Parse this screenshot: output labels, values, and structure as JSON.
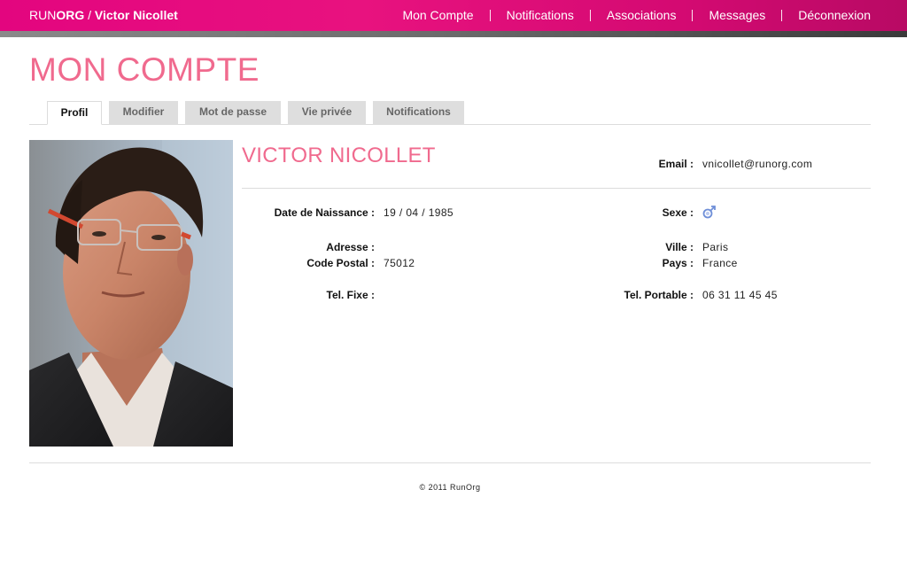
{
  "header": {
    "brand_prefix": "RUN",
    "brand_bold": "ORG",
    "brand_sep": " / ",
    "user_name": "Victor Nicollet",
    "nav": [
      "Mon Compte",
      "Notifications",
      "Associations",
      "Messages",
      "Déconnexion"
    ]
  },
  "page": {
    "title": "MON COMPTE"
  },
  "tabs": [
    {
      "label": "Profil",
      "active": true
    },
    {
      "label": "Modifier",
      "active": false
    },
    {
      "label": "Mot de passe",
      "active": false
    },
    {
      "label": "Vie privée",
      "active": false
    },
    {
      "label": "Notifications",
      "active": false
    }
  ],
  "profile": {
    "name": "VICTOR NICOLLET",
    "email_label": "Email :",
    "email": "vnicollet@runorg.com",
    "birth_label": "Date de Naissance :",
    "birth": "19 / 04 / 1985",
    "sex_label": "Sexe :",
    "sex_icon": "male-icon",
    "address_label": "Adresse :",
    "address": "",
    "city_label": "Ville :",
    "city": "Paris",
    "postal_label": "Code Postal :",
    "postal": "75012",
    "country_label": "Pays :",
    "country": "France",
    "phone_label": "Tel. Fixe :",
    "phone": "",
    "mobile_label": "Tel. Portable :",
    "mobile": "06 31 11 45 45"
  },
  "footer": {
    "copyright": "© 2011 RunOrg"
  },
  "colors": {
    "brand_pink": "#e3057f",
    "title_pink": "#f06a8e",
    "sex_icon_blue": "#6f8fd8"
  }
}
